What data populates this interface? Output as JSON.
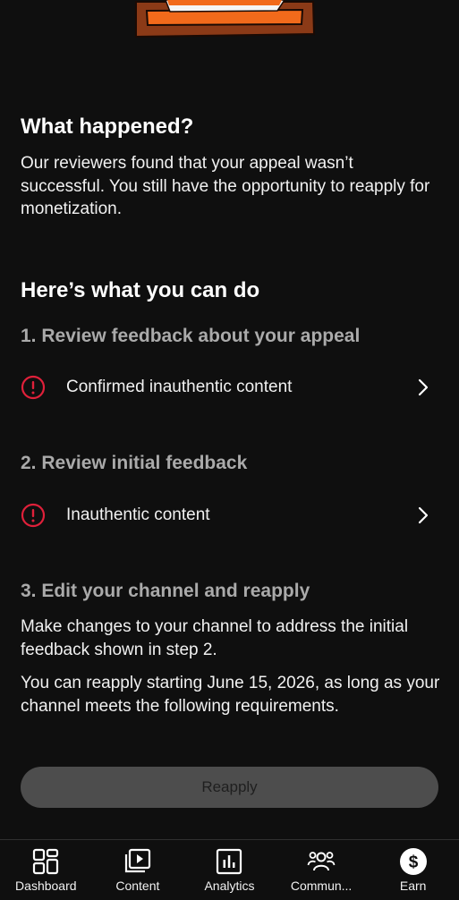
{
  "section1": {
    "title": "What happened?",
    "body": "Our reviewers found that your appeal wasn’t successful. You still have the opportunity to reapply for monetization."
  },
  "section2": {
    "title": "Here’s what you can do",
    "step1": {
      "heading": "1. Review feedback about your appeal",
      "row_label": "Confirmed inauthentic content"
    },
    "step2": {
      "heading": "2. Review initial feedback",
      "row_label": "Inauthentic content"
    },
    "step3": {
      "heading": "3. Edit your channel and reapply",
      "body1": "Make changes to your channel to address the initial feedback shown in step 2.",
      "body2": "You can reapply starting June 15, 2026, as long as your channel meets the following requirements."
    }
  },
  "reapply_button": {
    "label": "Reapply"
  },
  "bottom_nav": {
    "items": [
      {
        "label": "Dashboard",
        "icon": "dashboard-icon"
      },
      {
        "label": "Content",
        "icon": "content-icon"
      },
      {
        "label": "Analytics",
        "icon": "analytics-icon"
      },
      {
        "label": "Commun...",
        "icon": "community-icon"
      },
      {
        "label": "Earn",
        "icon": "earn-icon"
      }
    ]
  },
  "colors": {
    "background": "#0f0f0f",
    "alert": "#e0203a",
    "button_disabled_bg": "#4d4d4d",
    "secondary_text": "#aaaaaa",
    "cone_orange": "#f26a1b",
    "cone_base": "#8b3a17"
  }
}
